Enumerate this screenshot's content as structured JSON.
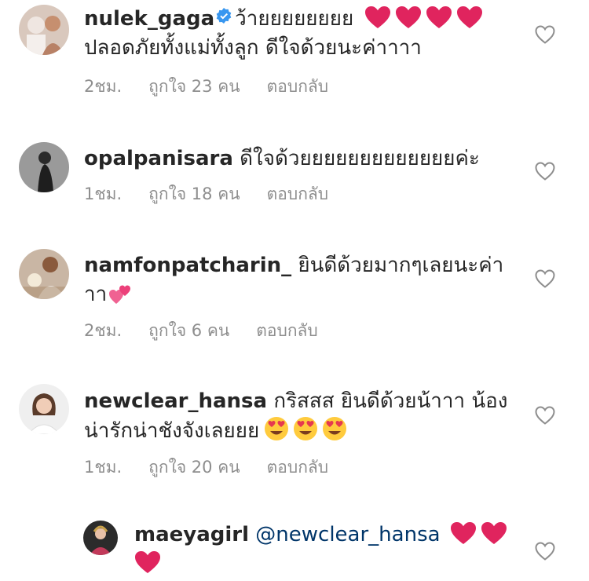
{
  "comments": [
    {
      "username": "nulek_gaga",
      "verified": true,
      "text": "ว้ายยยยยยยย",
      "emoji_after": [
        "heart",
        "heart",
        "heart",
        "heart"
      ],
      "text2": "ปลอดภัยทั้งแม่ทั้งลูก ดีใจด้วยนะค่าาาา",
      "time": "2ชม.",
      "likes": "ถูกใจ 23 คน",
      "reply": "ตอบกลับ"
    },
    {
      "username": "opalpanisara",
      "text": "ดีใจด้วยยยยยยยยยยยยยค่ะ",
      "time": "1ชม.",
      "likes": "ถูกใจ 18 คน",
      "reply": "ตอบกลับ"
    },
    {
      "username": "namfonpatcharin_",
      "text": "ยินดีด้วยมากๆเลยนะค่า",
      "text2": "าา",
      "emoji_after": [
        "two-hearts"
      ],
      "time": "2ชม.",
      "likes": "ถูกใจ 6 คน",
      "reply": "ตอบกลับ"
    },
    {
      "username": "newclear_hansa",
      "text": "กริสสส ยินดีด้วยน้าาา น้อง",
      "text2": "น่ารักน่าชังจังเลยยย",
      "emoji_after": [
        "heart-eyes",
        "heart-eyes",
        "heart-eyes"
      ],
      "time": "1ชม.",
      "likes": "ถูกใจ 20 คน",
      "reply": "ตอบกลับ"
    },
    {
      "username": "maeyagirl",
      "mention": "@newclear_hansa",
      "emoji_after": [
        "heart",
        "heart",
        "heart"
      ],
      "is_reply": true
    }
  ],
  "icons": {
    "like": "heart-outline-icon",
    "verified": "verified-badge-icon"
  },
  "colors": {
    "meta": "#8e8e8e",
    "mention": "#003569",
    "heart": "#e0245e",
    "verified": "#3897f0"
  }
}
